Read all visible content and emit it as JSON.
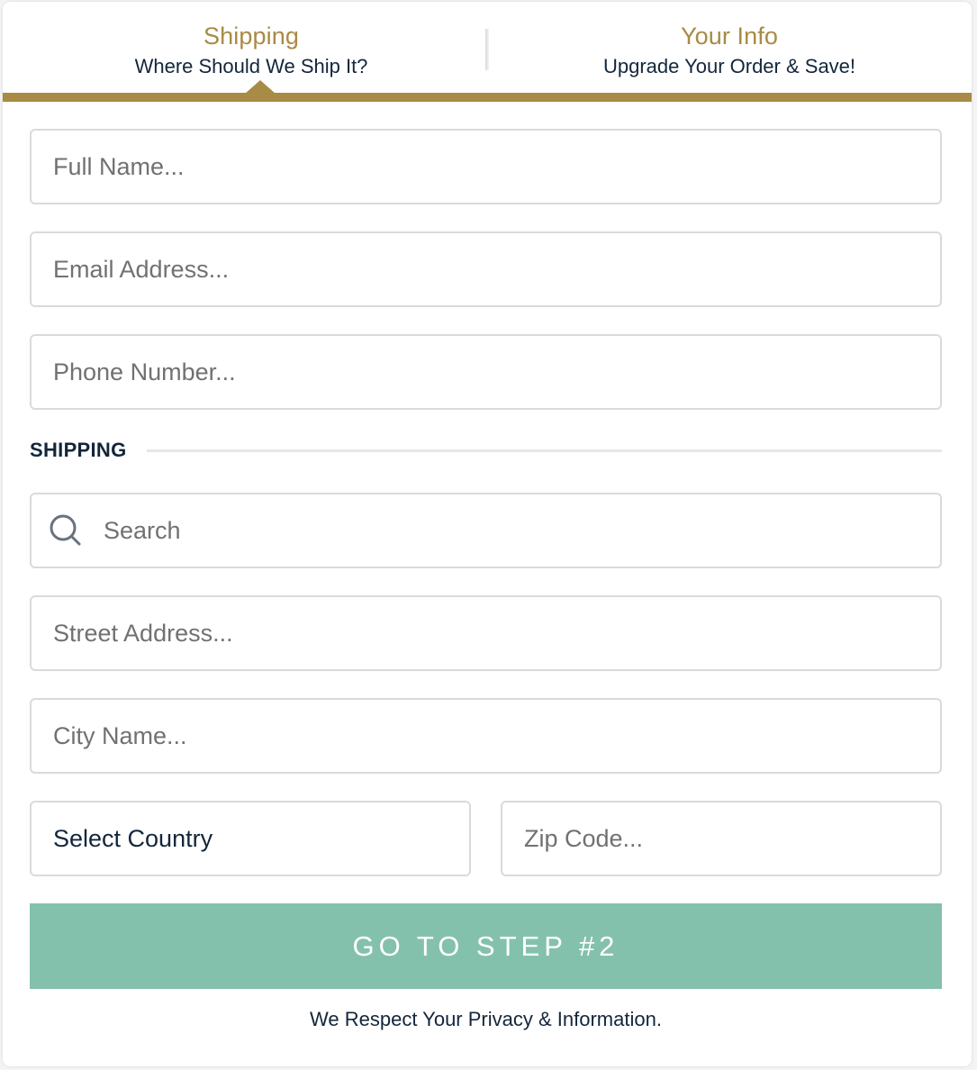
{
  "tabs": [
    {
      "title": "Shipping",
      "subtitle": "Where Should We Ship It?"
    },
    {
      "title": "Your Info",
      "subtitle": "Upgrade Your Order & Save!"
    }
  ],
  "fields": {
    "full_name": {
      "placeholder": "Full Name...",
      "value": ""
    },
    "email": {
      "placeholder": "Email Address...",
      "value": ""
    },
    "phone": {
      "placeholder": "Phone Number...",
      "value": ""
    },
    "search": {
      "placeholder": "Search",
      "value": "",
      "icon": "search-icon"
    },
    "street": {
      "placeholder": "Street Address...",
      "value": ""
    },
    "city": {
      "placeholder": "City Name...",
      "value": ""
    },
    "country": {
      "selected": "Select Country"
    },
    "zip": {
      "placeholder": "Zip Code...",
      "value": ""
    }
  },
  "section": {
    "label": "SHIPPING"
  },
  "submit_button": {
    "label": "GO TO STEP #2"
  },
  "privacy_text": "We Respect Your Privacy & Information.",
  "colors": {
    "accent": "#a88b44",
    "button": "#84c1ad",
    "text_dark": "#13263a",
    "border": "#dadada"
  }
}
